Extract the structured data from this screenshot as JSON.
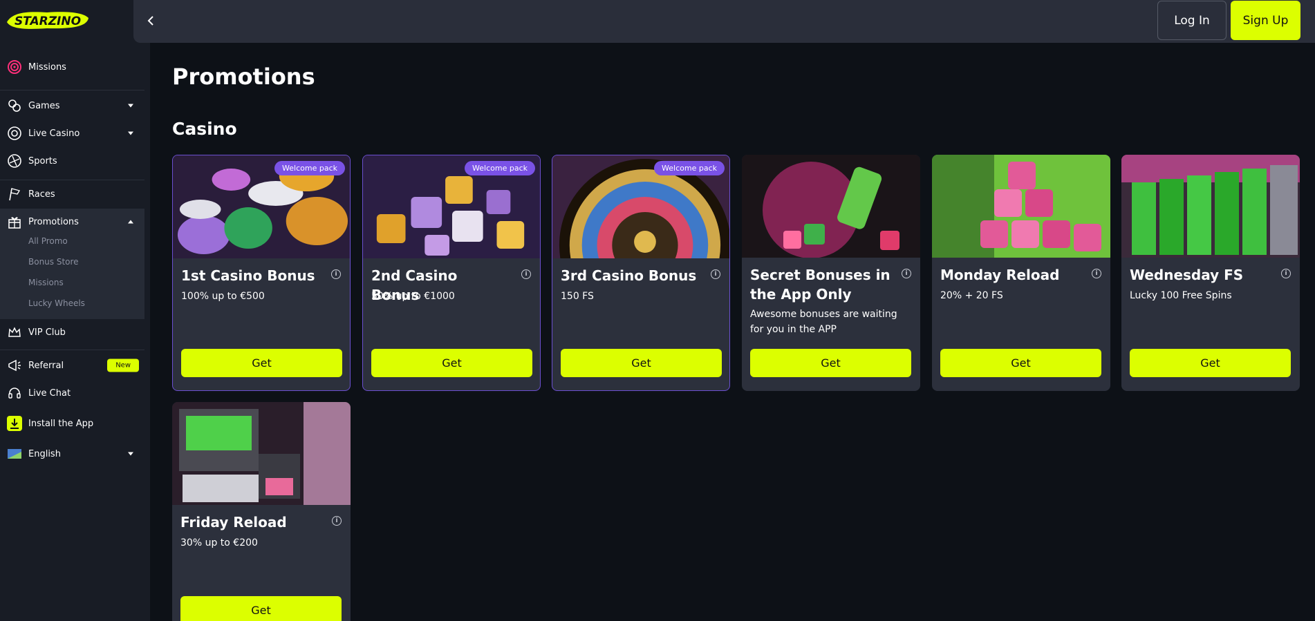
{
  "brand": {
    "logo_text": "STARZINO",
    "accent": "#dcff00",
    "welcome_color": "#7a52e6"
  },
  "sidebar": {
    "items": [
      {
        "label": "Missions",
        "icon": "target-icon"
      },
      {
        "label": "Games",
        "icon": "games-icon"
      },
      {
        "label": "Live Casino",
        "icon": "roulette-icon"
      },
      {
        "label": "Sports",
        "icon": "ball-icon"
      },
      {
        "label": "Races",
        "icon": "flag-icon"
      },
      {
        "label": "Promotions",
        "icon": "gift-icon"
      },
      {
        "label": "VIP Club",
        "icon": "crown-icon"
      },
      {
        "label": "Referral",
        "icon": "megaphone-icon",
        "badge": "New"
      },
      {
        "label": "Live Chat",
        "icon": "headset-icon"
      },
      {
        "label": "Install the App",
        "icon": "download-icon"
      },
      {
        "label": "English",
        "icon": "flag-en-icon"
      }
    ],
    "promotions_sub": [
      "All Promo",
      "Bonus Store",
      "Missions",
      "Lucky Wheels"
    ]
  },
  "header": {
    "login": "Log In",
    "signup": "Sign Up"
  },
  "main": {
    "title": "Promotions",
    "section": "Casino",
    "get_label": "Get",
    "welcome_badge": "Welcome pack",
    "cards": [
      {
        "title": "1st Casino Bonus",
        "desc": "100% up to €500",
        "welcome": true
      },
      {
        "title": "2nd Casino Bonus",
        "desc": "50% up to €1000",
        "welcome": true
      },
      {
        "title": "3rd Casino Bonus",
        "desc": "150 FS",
        "welcome": true
      },
      {
        "title": "Secret Bonuses in the App Only",
        "desc": "Awesome bonuses are waiting for you in the APP",
        "welcome": false
      },
      {
        "title": "Monday Reload",
        "desc": "20% + 20 FS",
        "welcome": false
      },
      {
        "title": "Wednesday FS",
        "desc": "Lucky 100 Free Spins",
        "welcome": false
      },
      {
        "title": "Friday Reload",
        "desc": "30% up to €200",
        "welcome": false
      }
    ]
  }
}
